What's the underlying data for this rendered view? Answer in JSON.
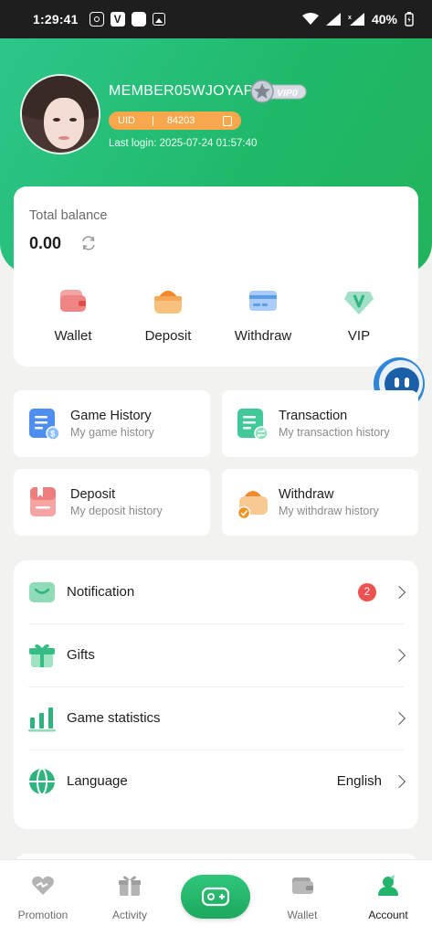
{
  "status_bar": {
    "time": "1:29:41",
    "battery": "40%"
  },
  "profile": {
    "username": "MEMBER05WJOYAP",
    "vip_level": "VIP0",
    "uid_label": "UID",
    "uid_separator": "|",
    "uid_value": "84203",
    "last_login": "Last login: 2025-07-24 01:57:40"
  },
  "balance": {
    "label": "Total balance",
    "value": "0.00",
    "actions": [
      {
        "label": "Wallet",
        "icon": "wallet-icon"
      },
      {
        "label": "Deposit",
        "icon": "deposit-icon"
      },
      {
        "label": "Withdraw",
        "icon": "withdraw-icon"
      },
      {
        "label": "VIP",
        "icon": "vip-icon"
      }
    ]
  },
  "history_tiles": [
    {
      "title": "Game History",
      "subtitle": "My game history",
      "icon": "game-history-icon"
    },
    {
      "title": "Transaction",
      "subtitle": "My transaction history",
      "icon": "transaction-icon"
    },
    {
      "title": "Deposit",
      "subtitle": "My deposit history",
      "icon": "deposit-history-icon"
    },
    {
      "title": "Withdraw",
      "subtitle": "My withdraw history",
      "icon": "withdraw-history-icon"
    }
  ],
  "settings": {
    "notification": {
      "label": "Notification",
      "badge": "2"
    },
    "gifts": {
      "label": "Gifts"
    },
    "game_statistics": {
      "label": "Game statistics"
    },
    "language": {
      "label": "Language",
      "value": "English"
    }
  },
  "bottom_nav": [
    {
      "label": "Promotion",
      "icon": "promotion-icon"
    },
    {
      "label": "Activity",
      "icon": "activity-icon"
    },
    {
      "label": "",
      "icon": "game-controller-icon"
    },
    {
      "label": "Wallet",
      "icon": "wallet-nav-icon"
    },
    {
      "label": "Account",
      "icon": "account-icon",
      "active": true
    }
  ],
  "colors": {
    "primary_green": "#22b45c",
    "uid_orange": "#f7a84d",
    "badge_red": "#ef5050"
  }
}
